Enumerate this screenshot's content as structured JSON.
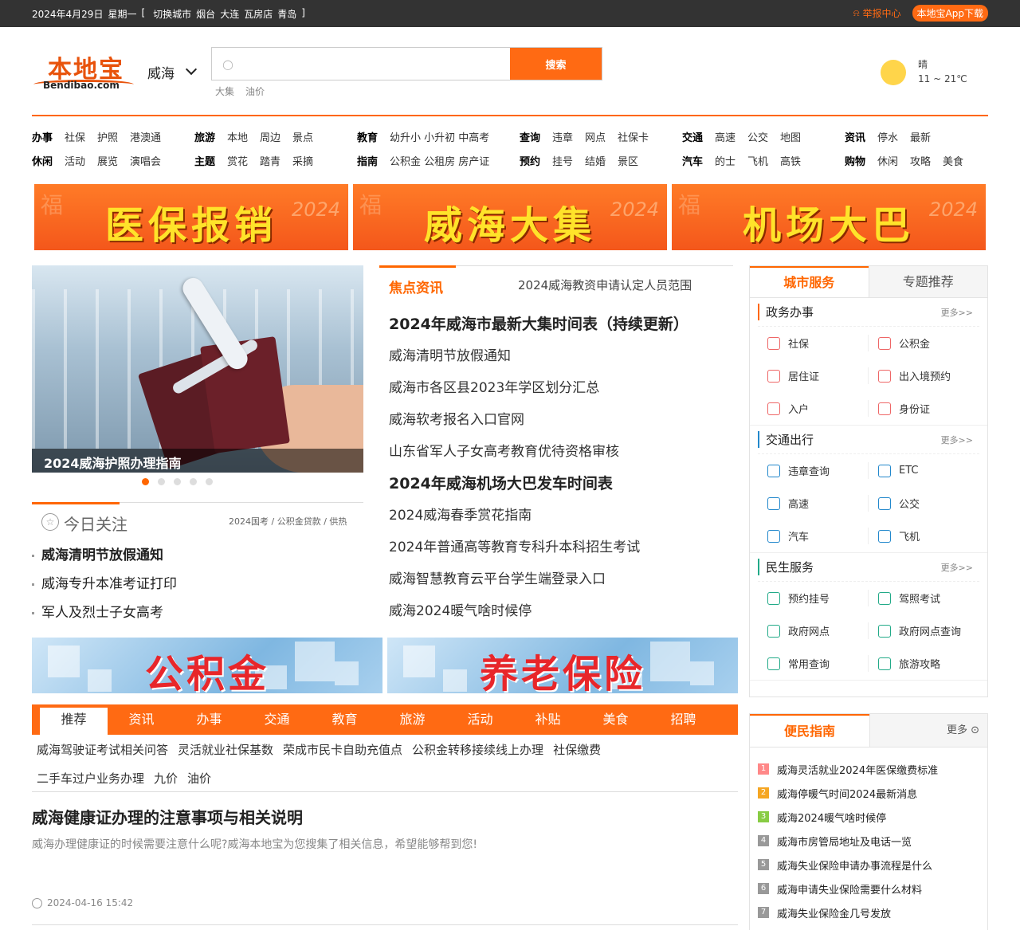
{
  "topbar": {
    "date": "2024年4月29日",
    "weekday": "星期一",
    "switch_open": "[",
    "switch_label": "切换城市",
    "cities": [
      "烟台",
      "大连",
      "瓦房店",
      "青岛"
    ],
    "switch_close": "]",
    "report": "举报中心",
    "app_download": "本地宝App下载"
  },
  "header": {
    "logo_cn": "本地宝",
    "logo_en": "Bendibao.com",
    "city": "威海",
    "search_button": "搜索",
    "hotwords": [
      "大集",
      "油价"
    ],
    "weather_desc": "晴",
    "weather_temp": "11 ~ 21℃"
  },
  "nav": [
    {
      "rows": [
        [
          "办事",
          "社保",
          "护照",
          "港澳通"
        ],
        [
          "休闲",
          "活动",
          "展览",
          "演唱会"
        ]
      ]
    },
    {
      "rows": [
        [
          "旅游",
          "本地",
          "周边",
          "景点"
        ],
        [
          "主题",
          "赏花",
          "踏青",
          "采摘"
        ]
      ]
    },
    {
      "rows": [
        [
          "教育",
          "幼升小 小升初 中高考"
        ],
        [
          "指南",
          "公积金 公租房 房产证"
        ]
      ]
    },
    {
      "rows": [
        [
          "查询",
          "违章",
          "网点",
          "社保卡"
        ],
        [
          "预约",
          "挂号",
          "结婚",
          "景区"
        ]
      ]
    },
    {
      "rows": [
        [
          "交通",
          "高速",
          "公交",
          "地图"
        ],
        [
          "汽车",
          "的士",
          "飞机",
          "高铁"
        ]
      ]
    },
    {
      "rows": [
        [
          "资讯",
          "停水",
          "最新"
        ],
        [
          "购物",
          "休闲",
          "攻略",
          "美食"
        ]
      ]
    }
  ],
  "banners": [
    {
      "text": "医保报销",
      "year": "2024",
      "fu": "福"
    },
    {
      "text": "威海大集",
      "year": "2024",
      "fu": "福"
    },
    {
      "text": "机场大巴",
      "year": "2024",
      "fu": "福"
    }
  ],
  "slider": {
    "caption": "2024威海护照办理指南",
    "dots": 5,
    "active": 0
  },
  "focus": {
    "title": "今日关注",
    "tags": "2024国考 / 公积金贷款 / 供热",
    "items": [
      "威海清明节放假通知",
      "威海专升本准考证打印",
      "军人及烈士子女高考"
    ]
  },
  "news": {
    "label": "焦点资讯",
    "sub": "2024威海教资申请认定人员范围",
    "items": [
      {
        "t": "2024年威海市最新大集时间表（持续更新）",
        "h": true
      },
      {
        "t": "威海清明节放假通知",
        "h": false
      },
      {
        "t": "威海市各区县2023年学区划分汇总",
        "h": false
      },
      {
        "t": "威海软考报名入口官网",
        "h": false
      },
      {
        "t": "山东省军人子女高考教育优待资格审核",
        "h": false
      },
      {
        "t": "2024年威海机场大巴发车时间表",
        "h": true
      },
      {
        "t": "2024威海春季赏花指南",
        "h": false
      },
      {
        "t": "2024年普通高等教育专科升本科招生考试",
        "h": false
      },
      {
        "t": "威海智慧教育云平台学生端登录入口",
        "h": false
      },
      {
        "t": "威海2024暖气啥时候停",
        "h": false
      }
    ]
  },
  "banners2": [
    "公积金",
    "养老保险"
  ],
  "tabs": [
    "推荐",
    "资讯",
    "办事",
    "交通",
    "教育",
    "旅游",
    "活动",
    "补贴",
    "美食",
    "招聘"
  ],
  "keywords": [
    [
      "威海驾驶证考试相关问答",
      "灵活就业社保基数",
      "荣成市民卡自助充值点",
      "公积金转移接续线上办理",
      "社保缴费"
    ],
    [
      "二手车过户业务办理",
      "九价",
      "油价"
    ]
  ],
  "article": {
    "title": "威海健康证办理的注意事项与相关说明",
    "summary": "威海办理健康证的时候需要注意什么呢?威海本地宝为您搜集了相关信息，希望能够帮到您!",
    "time": "2024-04-16 15:42"
  },
  "services": {
    "tab_active": "城市服务",
    "tab_other": "专题推荐",
    "more": "更多>>",
    "sections": [
      {
        "name": "政务办事",
        "items": [
          "社保",
          "公积金",
          "居住证",
          "出入境预约",
          "入户",
          "身份证"
        ]
      },
      {
        "name": "交通出行",
        "items": [
          "违章查询",
          "ETC",
          "高速",
          "公交",
          "汽车",
          "飞机"
        ]
      },
      {
        "name": "民生服务",
        "items": [
          "预约挂号",
          "驾照考试",
          "政府网点",
          "政府网点查询",
          "常用查询",
          "旅游攻略"
        ]
      }
    ]
  },
  "guide": {
    "title": "便民指南",
    "more": "更多",
    "items": [
      "威海灵活就业2024年医保缴费标准",
      "威海停暖气时间2024最新消息",
      "威海2024暖气啥时候停",
      "威海市房管局地址及电话一览",
      "威海失业保险申请办事流程是什么",
      "威海申请失业保险需要什么材料",
      "威海失业保险金几号发放"
    ],
    "num_colors": [
      "#f88",
      "#f5a623",
      "#8c4",
      "#999",
      "#999",
      "#999",
      "#999"
    ]
  }
}
